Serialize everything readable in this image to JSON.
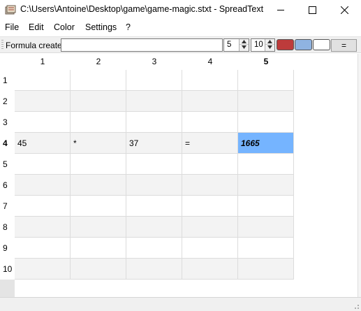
{
  "window": {
    "title": "C:\\Users\\Antoine\\Desktop\\game\\game-magic.stxt - SpreadText",
    "icon": "spreadsheet-app-icon"
  },
  "menu": [
    "File",
    "Edit",
    "Color",
    "Settings",
    "?"
  ],
  "toolbar": {
    "status": "Formula created",
    "formula_value": "",
    "col_field": "5",
    "row_field": "10",
    "swatch_colors": [
      "#bd3b3b",
      "#8fb3e1",
      "#ffffff"
    ],
    "eq_label": "="
  },
  "grid": {
    "columns": [
      "1",
      "2",
      "3",
      "4",
      "5"
    ],
    "rows": [
      "1",
      "2",
      "3",
      "4",
      "5",
      "6",
      "7",
      "8",
      "9",
      "10"
    ],
    "active_row": 4,
    "active_col": 5,
    "cells": {
      "4": [
        "45",
        "*",
        "37",
        "=",
        "1665"
      ]
    },
    "selected_color": "#75b4ff"
  }
}
